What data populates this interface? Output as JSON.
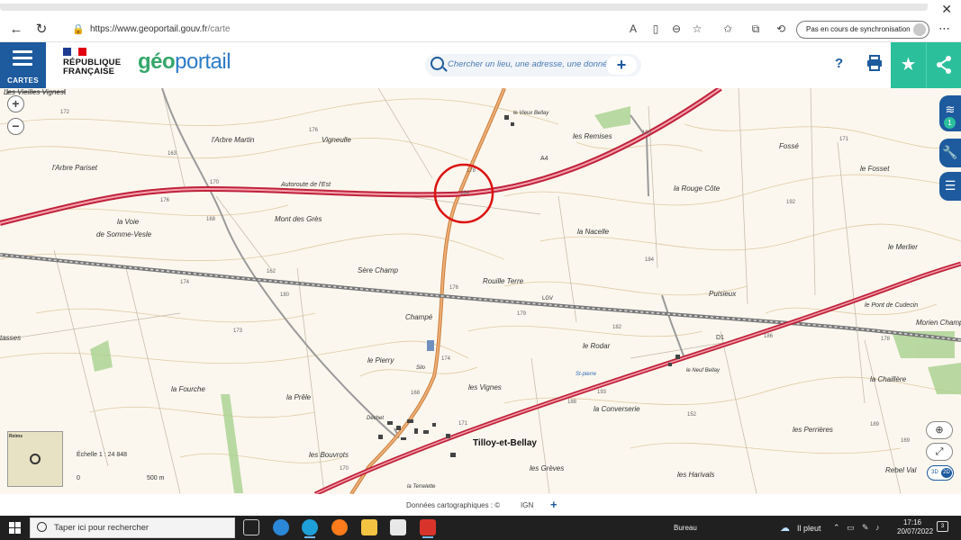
{
  "browser": {
    "url_base": "https://www.geoportail.gouv.fr",
    "url_path": "/carte",
    "sync_label": "Pas en cours de synchronisation",
    "close_glyph": "✕"
  },
  "header": {
    "menu_label": "CARTES",
    "republique_line1": "RÉPUBLIQUE",
    "republique_line2": "FRANÇAISE",
    "logo_geo": "géo",
    "logo_portail": "portail",
    "search_placeholder": "Chercher un lieu, une adresse, une donnée",
    "help_label": "?",
    "colors": {
      "brand_blue": "#1d5a9e",
      "accent_green": "#2bbf9c",
      "logo_green": "#35a76a",
      "logo_blue": "#2e7cc6"
    }
  },
  "map": {
    "scale_text": "Échelle 1 : 24 848",
    "scale_start": "0",
    "scale_end": "500 m",
    "mini_map_label": "Reims",
    "view_mode": "2D",
    "view_mode_alt": "3D",
    "places": [
      {
        "name": "Les Vieilles Vignes"
      },
      {
        "name": "l'Arbre Martin"
      },
      {
        "name": "Vigneulle"
      },
      {
        "name": "le Vieux Bellay"
      },
      {
        "name": "les Remises"
      },
      {
        "name": "Fossé"
      },
      {
        "name": "l'Arbre Pariset"
      },
      {
        "name": "Autoroute   de   l'Est"
      },
      {
        "name": "le Fosset"
      },
      {
        "name": "la Rouge Côte"
      },
      {
        "name": "la Voie"
      },
      {
        "name": "de Somme-Vesle"
      },
      {
        "name": "Mont des Grès"
      },
      {
        "name": "la Nacelle"
      },
      {
        "name": "le Merlier"
      },
      {
        "name": "Sère Champ"
      },
      {
        "name": "Rouille Terre"
      },
      {
        "name": "Puisieux"
      },
      {
        "name": "le Pont de Cudecin"
      },
      {
        "name": "Morien Champ"
      },
      {
        "name": "Champé"
      },
      {
        "name": "le Rodar"
      },
      {
        "name": "tasses"
      },
      {
        "name": "le Pierry"
      },
      {
        "name": "le Neuf Bellay"
      },
      {
        "name": "St-pierre"
      },
      {
        "name": "la Chaillère"
      },
      {
        "name": "la Fourche"
      },
      {
        "name": "les Vignes"
      },
      {
        "name": "la Prêle"
      },
      {
        "name": "la Converserie"
      },
      {
        "name": "Tilloy-et-Bellay"
      },
      {
        "name": "les Perrières"
      },
      {
        "name": "les Bouvrots"
      },
      {
        "name": "les Grèves"
      },
      {
        "name": "Rebel Val"
      },
      {
        "name": "les Harivals"
      },
      {
        "name": "la Terrelette"
      },
      {
        "name": "Déchet"
      },
      {
        "name": "Silo"
      },
      {
        "name": "A4"
      },
      {
        "name": "D1"
      },
      {
        "name": "LGV"
      }
    ],
    "altitudes": [
      "172",
      "176",
      "163",
      "170",
      "176",
      "168",
      "190",
      "184",
      "178",
      "171",
      "192",
      "184",
      "162",
      "180",
      "174",
      "173",
      "176",
      "179",
      "182",
      "186",
      "178",
      "174",
      "193",
      "188",
      "152",
      "189",
      "170",
      "168",
      "171",
      "169"
    ]
  },
  "credits": {
    "text": "Données cartographiques : ©",
    "ign": "IGN",
    "plus": "+"
  },
  "taskbar": {
    "search_placeholder": "Taper ici pour rechercher",
    "bureau": "Bureau",
    "weather": "Il pleut",
    "time": "17:16",
    "date": "20/07/2022",
    "notification_count": "3"
  }
}
